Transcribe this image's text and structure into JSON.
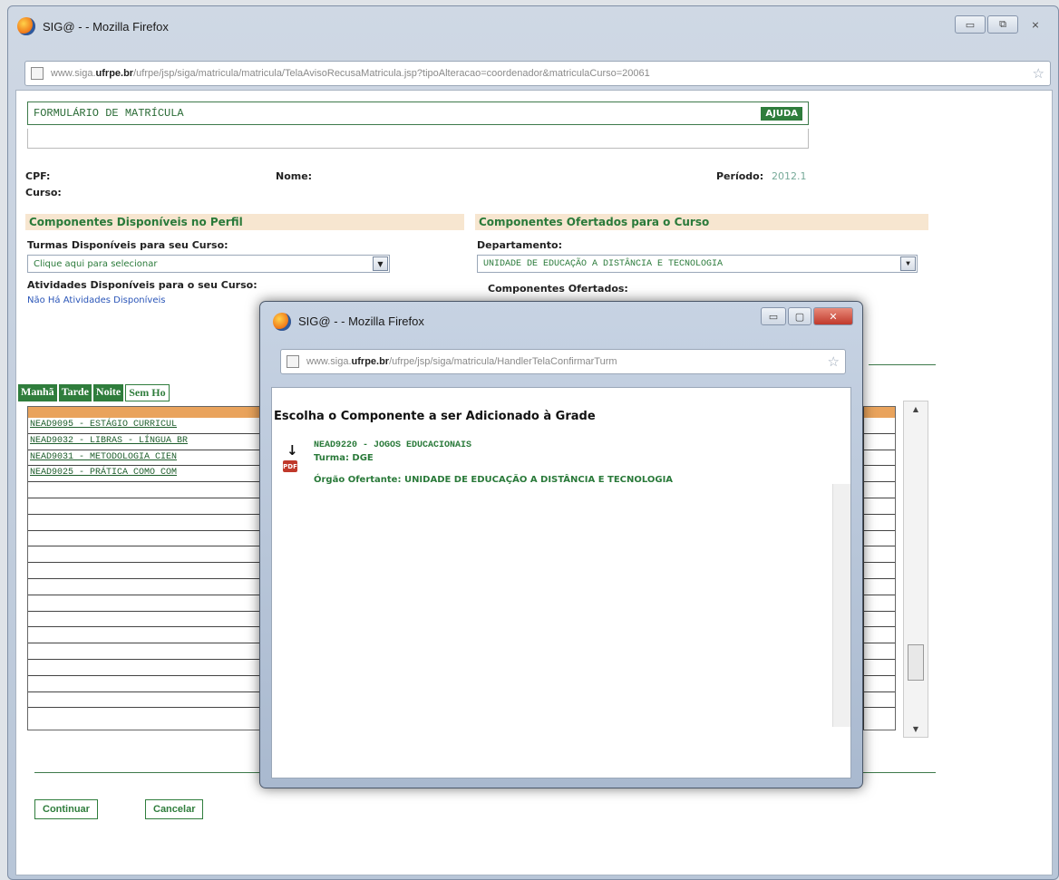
{
  "main_window": {
    "title": "SIG@ - - Mozilla Firefox",
    "url_prefix": "www.siga.",
    "url_domain": "ufrpe.br",
    "url_rest": "/ufrpe/jsp/siga/matricula/matricula/TelaAvisoRecusaMatricula.jsp?tipoAlteracao=coordenador&matriculaCurso=20061"
  },
  "form": {
    "title": "FORMULÁRIO DE MATRÍCULA",
    "help_label": "AJUDA",
    "cpf_label": "CPF:",
    "nome_label": "Nome:",
    "periodo_label": "Período:",
    "periodo_value": "2012.1",
    "curso_label": "Curso:",
    "section_left": "Componentes Disponíveis no Perfil",
    "section_right": "Componentes Ofertados para o Curso",
    "turmas_label": "Turmas Disponíveis para seu Curso:",
    "turmas_placeholder": "Clique aqui para selecionar",
    "departamento_label": "Departamento:",
    "departamento_value": "UNIDADE DE EDUCAÇÃO A DISTÂNCIA E TECNOLOGIA",
    "atividades_label": "Atividades Disponíveis para o seu Curso:",
    "atividades_empty": "Não Há Atividades Disponíveis",
    "ofertados_label": "Componentes Ofertados:",
    "shifts": [
      "Manhã",
      "Tarde",
      "Noite",
      "Sem Ho"
    ],
    "grid_rows": [
      "NEAD9095 - ESTÁGIO CURRICUL",
      "NEAD9032 - LIBRAS - LÍNGUA BR",
      "NEAD9031 - METODOLOGIA CIEN",
      "NEAD9025 - PRÁTICA COMO COM"
    ],
    "continue_label": "Continuar",
    "cancel_label": "Cancelar"
  },
  "popup": {
    "title": "SIG@ - - Mozilla Firefox",
    "url_prefix": "www.siga.",
    "url_domain": "ufrpe.br",
    "url_rest": "/ufrpe/jsp/siga/matricula/HandlerTelaConfirmarTurm",
    "heading": "Escolha o Componente a ser Adicionado à Grade",
    "component_title": "NEAD9220 - JOGOS EDUCACIONAIS",
    "turma": "Turma: DGE",
    "orgao": "Órgão Ofertante: UNIDADE DE EDUCAÇÃO A DISTÂNCIA E TECNOLOGIA"
  }
}
